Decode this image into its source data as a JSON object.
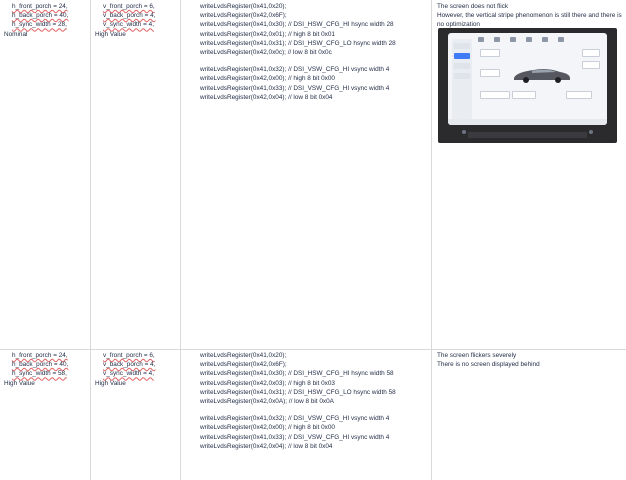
{
  "rows": [
    {
      "col1": [
        "h_front_porch = 24,",
        "h_back_porch = 40,",
        "h_sync_width = 28,",
        "Nominal"
      ],
      "col2": [
        "v_front_porch = 6,",
        "v_back_porch = 4,",
        "v_sync_width = 4,",
        "High Value"
      ],
      "col3": [
        "writeLvdsRegister(0x41,0x20);",
        "writeLvdsRegister(0x42,0x6F);",
        "writeLvdsRegister(0x41,0x30); // DSI_HSW_CFG_HI hsync width 28",
        "writeLvdsRegister(0x42,0x01); // high 8 bit 0x01",
        "writeLvdsRegister(0x41,0x31); // DSI_HSW_CFG_LO hsync width 28",
        "writeLvdsRegister(0x42,0x0c); // low 8 bit 0x0c",
        "",
        "writeLvdsRegister(0x41,0x32); // DSI_VSW_CFG_HI vsync width 4",
        "writeLvdsRegister(0x42,0x00); // high 8 bit 0x00",
        "writeLvdsRegister(0x41,0x33); // DSI_VSW_CFG_HI vsync width 4",
        "writeLvdsRegister(0x42,0x04); // low 8 bit 0x04"
      ],
      "col4": [
        "The screen does not flick",
        "However, the vertical stripe phenomenon is still there and there is no optimization"
      ]
    },
    {
      "col1": [
        "h_front_porch = 24,",
        "h_back_porch = 40,",
        "h_sync_width = 58,",
        "High Value"
      ],
      "col2": [
        "v_front_porch = 6,",
        "v_back_porch = 4,",
        "v_sync_width = 4,",
        "High Value"
      ],
      "col3": [
        "writeLvdsRegister(0x41,0x20);",
        "writeLvdsRegister(0x42,0x6F);",
        "writeLvdsRegister(0x41,0x30); // DSI_HSW_CFG_HI hsync width 58",
        "writeLvdsRegister(0x42,0x03); // high 8 bit 0x03",
        "writeLvdsRegister(0x41,0x31); // DSI_HSW_CFG_LO hsync width 58",
        "writeLvdsRegister(0x42,0x0A); // low 8 bit 0x0A",
        "",
        "writeLvdsRegister(0x41,0x32); // DSI_VSW_CFG_HI vsync width 4",
        "writeLvdsRegister(0x42,0x00); // high 8 bit 0x00",
        "writeLvdsRegister(0x41,0x33); // DSI_VSW_CFG_HI vsync width 4",
        "writeLvdsRegister(0x42,0x04); // low 8 bit 0x04"
      ],
      "col4": [
        "The screen flickers severely",
        "There is no screen displayed behind"
      ]
    }
  ],
  "colors": {
    "text": "#1f2a44",
    "grid": "#d9d9d9",
    "squiggle": "#e06060",
    "accent": "#3f7bf6"
  }
}
